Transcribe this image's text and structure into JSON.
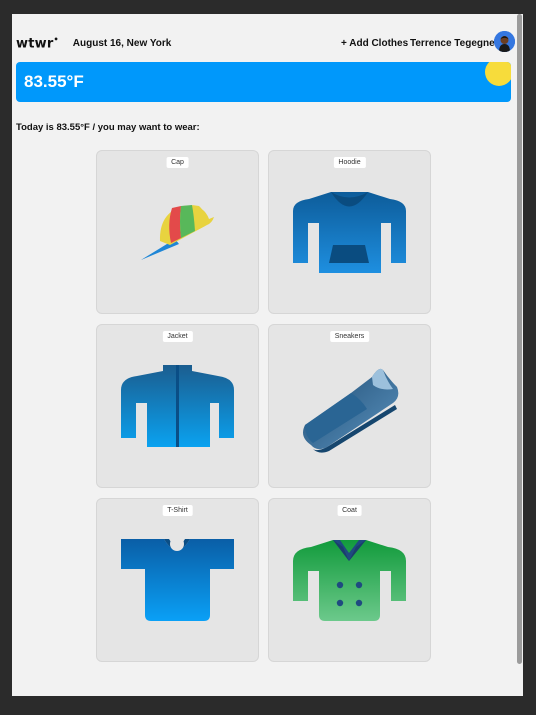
{
  "header": {
    "logo": "wtwr",
    "date_location": "August 16, New York",
    "add_clothes": "+ Add Clothes",
    "user_name": "Terrence Tegegne"
  },
  "weather": {
    "temperature": "83.55°F",
    "banner_color": "#0098fb",
    "sun_color": "#f7dc3b"
  },
  "advice": "Today is 83.55°F / you may want to wear:",
  "items": [
    {
      "name": "Cap"
    },
    {
      "name": "Hoodie"
    },
    {
      "name": "Jacket"
    },
    {
      "name": "Sneakers"
    },
    {
      "name": "T-Shirt"
    },
    {
      "name": "Coat"
    }
  ]
}
